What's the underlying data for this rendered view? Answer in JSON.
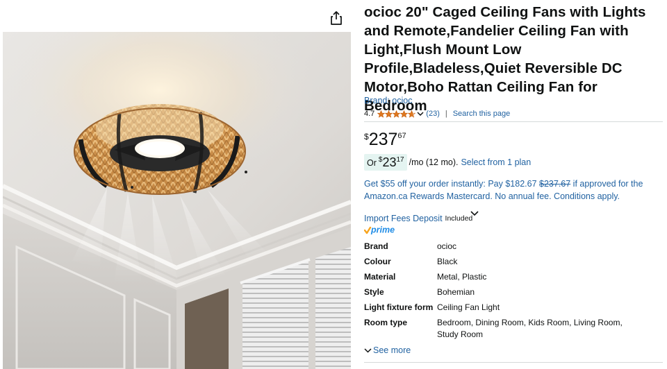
{
  "product": {
    "title": "ocioc 20\" Caged Ceiling Fans with Lights and Remote,Fandelier Ceiling Fan with Light,Flush Mount Low Profile,Bladeless,Quiet Reversible DC Motor,Boho Rattan Ceiling Fan for Bedroom",
    "brand_link": "Brand: ocioc",
    "image_alt": "Boho rattan caged ceiling fan with light installed on a white ceiling",
    "share_icon": "share-icon"
  },
  "rating": {
    "value": "4.7",
    "stars": 4.7,
    "count": "(23)",
    "separator": "|",
    "search_link": "Search this page",
    "star_color": "#de7921"
  },
  "price": {
    "symbol": "$",
    "whole": "237",
    "fraction": "67"
  },
  "monthly": {
    "or": "Or",
    "symbol": "$",
    "whole": "23",
    "fraction": "17",
    "term": "/mo (12 mo).",
    "plan_link": "Select from 1 plan",
    "chip_color": "#e4f4f1"
  },
  "offer": {
    "text_before": "Get $55 off your order instantly: Pay $182.67 ",
    "strike": "$237.67",
    "text_after": " if approved for the Amazon.ca Rewards Mastercard. No annual fee. Conditions apply."
  },
  "import_fees": {
    "link": "Import Fees Deposit",
    "included": "Included"
  },
  "prime": {
    "label": "prime",
    "check_color": "#f7a41d",
    "text_color": "#1f8ce6"
  },
  "specs": [
    {
      "key": "Brand",
      "value": "ocioc"
    },
    {
      "key": "Colour",
      "value": "Black"
    },
    {
      "key": "Material",
      "value": "Metal, Plastic"
    },
    {
      "key": "Style",
      "value": "Bohemian"
    },
    {
      "key": "Light fixture form",
      "value": "Ceiling Fan Light"
    },
    {
      "key": "Room type",
      "value": "Bedroom, Dining Room, Kids Room, Living Room, Study Room"
    }
  ],
  "see_more": "See more",
  "colors": {
    "link": "#2162a1",
    "text": "#0f1111",
    "divider": "#d5d9d9"
  }
}
